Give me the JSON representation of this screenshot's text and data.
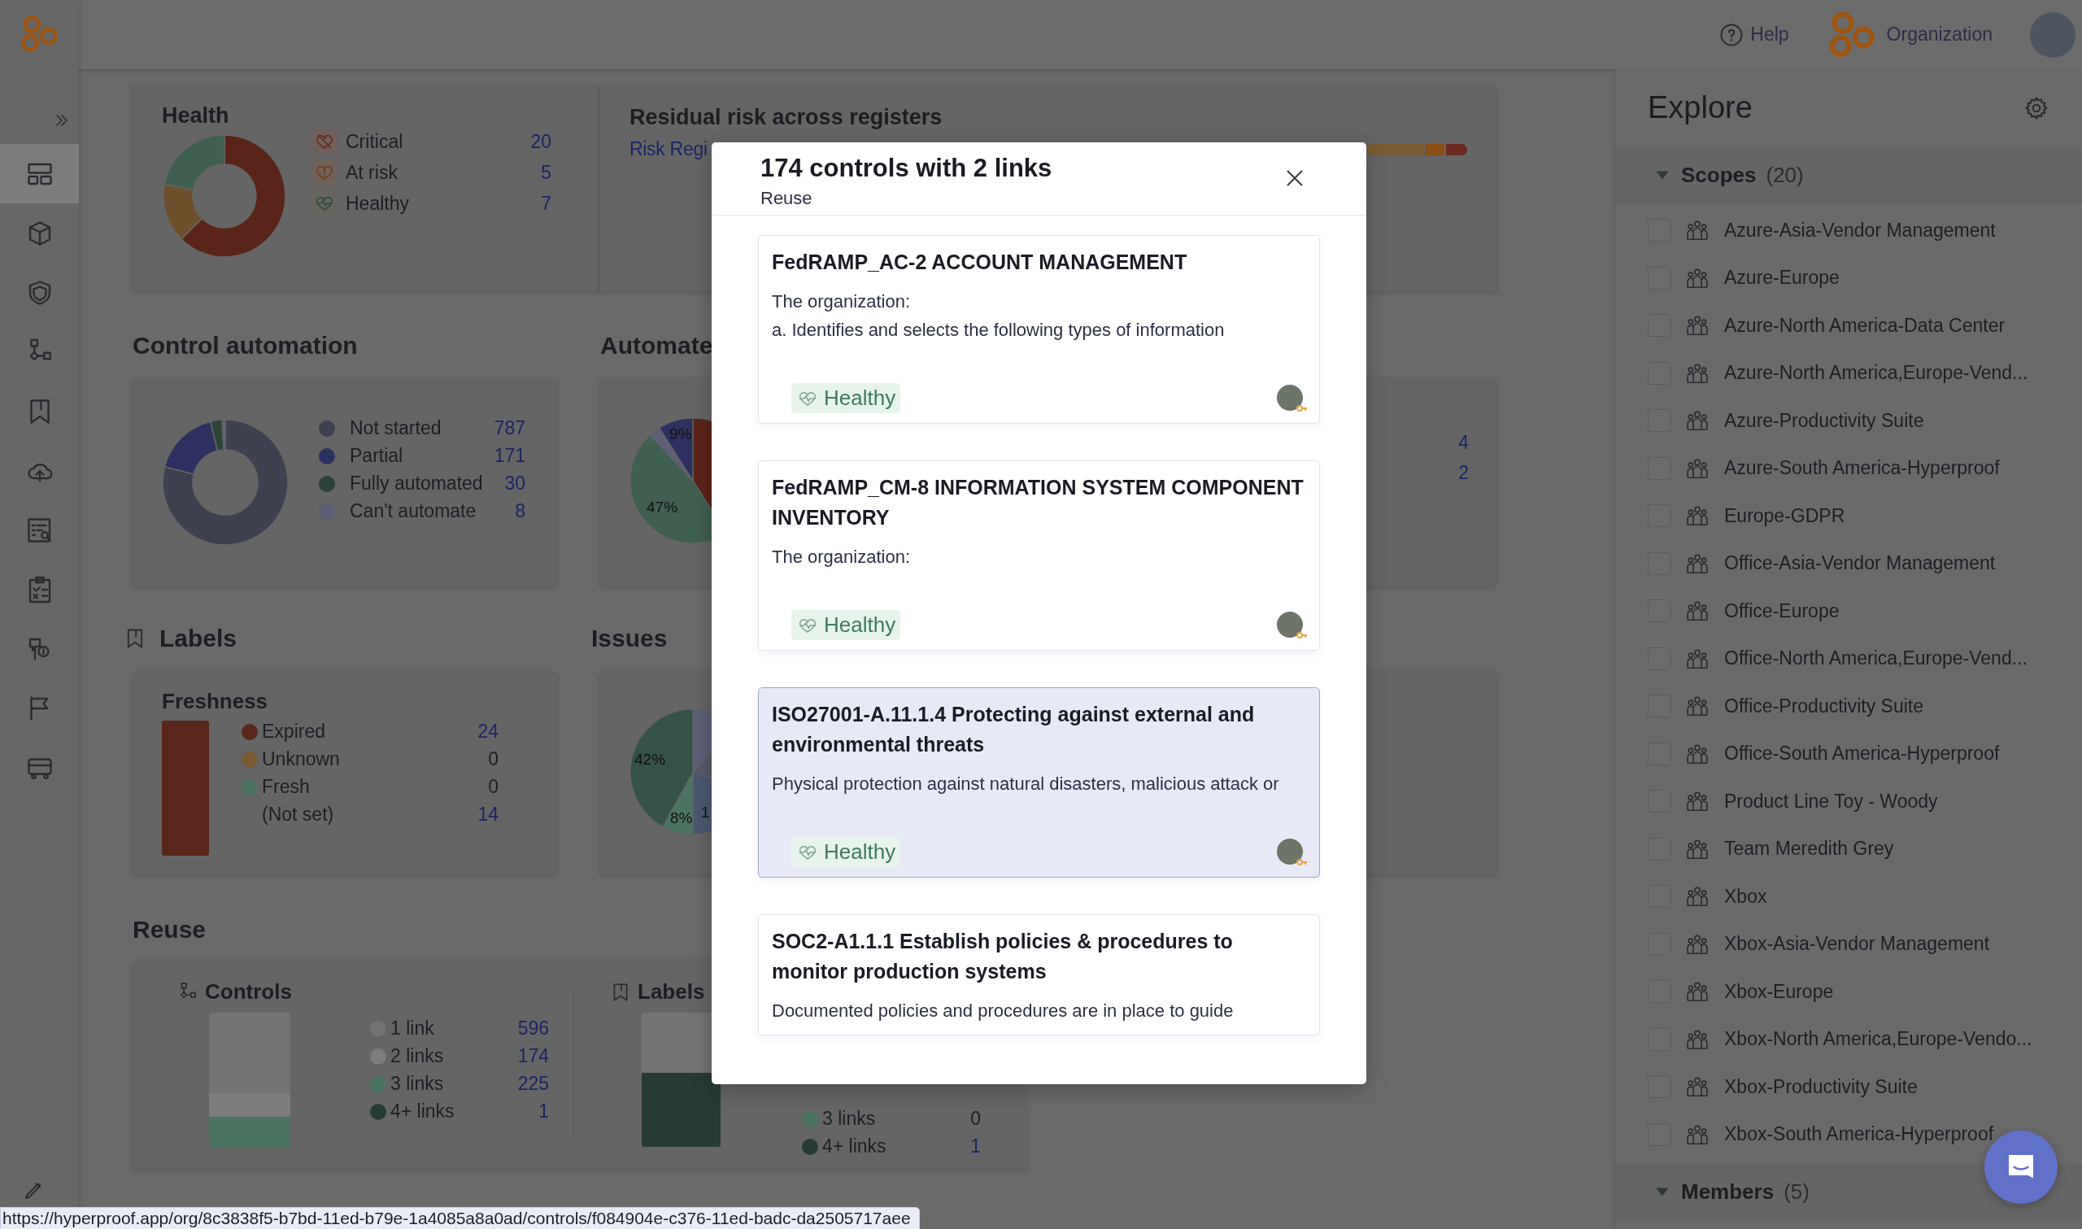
{
  "sidebar": {
    "items": [
      {
        "selected": true
      },
      {
        "selected": false
      },
      {
        "selected": false
      },
      {
        "selected": false
      },
      {
        "selected": false
      },
      {
        "selected": false
      },
      {
        "selected": false
      },
      {
        "selected": false
      },
      {
        "selected": false
      },
      {
        "selected": false
      },
      {
        "selected": false
      }
    ]
  },
  "topbar": {
    "help": "Help",
    "organization": "Organization"
  },
  "dashboard": {
    "health": {
      "title": "Health",
      "legend": [
        {
          "label": "Critical",
          "count": "20"
        },
        {
          "label": "At risk",
          "count": "5"
        },
        {
          "label": "Healthy",
          "count": "7"
        }
      ]
    },
    "residual": {
      "title": "Residual risk across registers",
      "link": "Risk Regi"
    },
    "control_automation": {
      "title": "Control automation",
      "legend": [
        {
          "label": "Not started",
          "count": "787",
          "color": "#3f4150"
        },
        {
          "label": "Partial",
          "count": "171",
          "color": "#2e3160"
        },
        {
          "label": "Fully automated",
          "count": "30",
          "color": "#2c4339"
        },
        {
          "label": "Can't automate",
          "count": "8",
          "color": "#5d5f78"
        }
      ]
    },
    "automated": {
      "title": "Automate",
      "pie_labels": [
        "9%",
        "47%"
      ],
      "values": [
        "4",
        "2"
      ]
    },
    "labels": {
      "title": "Labels",
      "card_title": "Freshness",
      "legend": [
        {
          "label": "Expired",
          "count": "24",
          "color": "#5a271b"
        },
        {
          "label": "Unknown",
          "count": "0",
          "color": "#7a5a33"
        },
        {
          "label": "Fresh",
          "count": "0",
          "color": "#4b7563"
        },
        {
          "label": "(Not set)",
          "count": "14"
        }
      ]
    },
    "issues": {
      "title": "Issues",
      "pie_labels": [
        "42%",
        "8%",
        "1"
      ]
    },
    "reuse": {
      "title": "Reuse",
      "controls": {
        "title": "Controls",
        "legend": [
          {
            "label": "1 link",
            "count": "596",
            "color": "#737373"
          },
          {
            "label": "2 links",
            "count": "174",
            "color": "#7c7c7c"
          },
          {
            "label": "3 links",
            "count": "225",
            "color": "#4b7563"
          },
          {
            "label": "4+ links",
            "count": "1",
            "color": "#263c33"
          }
        ]
      },
      "labels": {
        "title": "Labels",
        "legend": [
          {
            "label": "3 links",
            "count": "0",
            "color": "#4b7563"
          },
          {
            "label": "4+ links",
            "count": "1",
            "color": "#263c33"
          }
        ]
      }
    }
  },
  "explore": {
    "title": "Explore",
    "sections": [
      {
        "title": "Scopes",
        "count": "(20)",
        "expanded": true,
        "items": [
          {
            "label": "Azure-Asia-Vendor Management",
            "checked": false
          },
          {
            "label": "Azure-Europe",
            "checked": false
          },
          {
            "label": "Azure-North America-Data Center",
            "checked": false
          },
          {
            "label": "Azure-North America,Europe-Vend...",
            "checked": false
          },
          {
            "label": "Azure-Productivity Suite",
            "checked": false
          },
          {
            "label": "Azure-South America-Hyperproof",
            "checked": false
          },
          {
            "label": "Europe-GDPR",
            "checked": false
          },
          {
            "label": "Office-Asia-Vendor Management",
            "checked": false
          },
          {
            "label": "Office-Europe",
            "checked": false
          },
          {
            "label": "Office-North America,Europe-Vend...",
            "checked": false
          },
          {
            "label": "Office-Productivity Suite",
            "checked": false
          },
          {
            "label": "Office-South America-Hyperproof",
            "checked": false
          },
          {
            "label": "Product Line Toy - Woody",
            "checked": false
          },
          {
            "label": "Team Meredith Grey",
            "checked": false
          },
          {
            "label": "Xbox",
            "checked": false
          },
          {
            "label": "Xbox-Asia-Vendor Management",
            "checked": false
          },
          {
            "label": "Xbox-Europe",
            "checked": false
          },
          {
            "label": "Xbox-North America,Europe-Vendo...",
            "checked": false
          },
          {
            "label": "Xbox-Productivity Suite",
            "checked": false
          },
          {
            "label": "Xbox-South America-Hyperproof",
            "checked": false
          }
        ]
      },
      {
        "title": "Members",
        "count": "(5)",
        "expanded": true
      }
    ]
  },
  "modal": {
    "title": "174 controls with 2 links",
    "subtitle": "Reuse",
    "cards": [
      {
        "title": "FedRAMP_AC-2 ACCOUNT MANAGEMENT",
        "description": "The organization:\na. Identifies and selects the following types of information",
        "status": "Healthy",
        "selected": false
      },
      {
        "title": "FedRAMP_CM-8 INFORMATION SYSTEM COMPONENT INVENTORY",
        "description": "The organization:",
        "status": "Healthy",
        "selected": false
      },
      {
        "title": "ISO27001-A.11.1.4 Protecting against external and environmental threats",
        "description": "Physical protection against natural disasters, malicious attack or",
        "status": "Healthy",
        "selected": true
      },
      {
        "title": "SOC2-A1.1.1 Establish policies & procedures to monitor production systems",
        "description": "Documented policies and procedures are in place to guide",
        "selected": false
      }
    ]
  },
  "status_url": "https://hyperproof.app/org/8c3838f5-b7bd-11ed-b79e-1a4085a8a0ad/controls/f084904e-c376-11ed-badc-da2505717aee"
}
